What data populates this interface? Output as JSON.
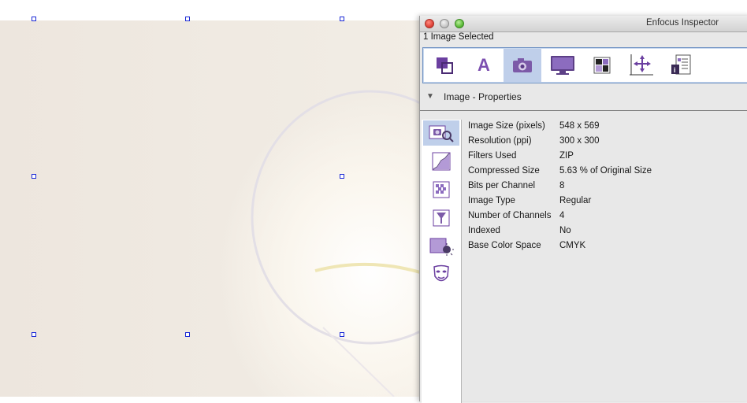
{
  "window": {
    "title": "Enfocus Inspector",
    "selection_label": "1 Image Selected"
  },
  "tabs": [
    {
      "name": "objects-icon"
    },
    {
      "name": "text-icon",
      "glyph": "A"
    },
    {
      "name": "camera-icon",
      "selected": true
    },
    {
      "name": "monitor-icon"
    },
    {
      "name": "color-swatches-icon"
    },
    {
      "name": "move-axes-icon"
    },
    {
      "name": "document-info-icon"
    }
  ],
  "section": {
    "disclosure": "▼",
    "title": "Image - Properties"
  },
  "side_icons": [
    {
      "name": "image-properties-icon",
      "selected": true
    },
    {
      "name": "curve-icon"
    },
    {
      "name": "halftone-icon"
    },
    {
      "name": "filter-funnel-icon"
    },
    {
      "name": "brightness-icon"
    },
    {
      "name": "mask-icon"
    }
  ],
  "properties": [
    {
      "label": "Image Size (pixels)",
      "value": "548 x 569"
    },
    {
      "label": "Resolution (ppi)",
      "value": "300 x 300"
    },
    {
      "label": "Filters Used",
      "value": "ZIP"
    },
    {
      "label": "Compressed Size",
      "value": "5.63 % of Original Size"
    },
    {
      "label": "Bits per Channel",
      "value": "8"
    },
    {
      "label": "Image Type",
      "value": "Regular"
    },
    {
      "label": "Number of Channels",
      "value": "4"
    },
    {
      "label": "Indexed",
      "value": "No"
    },
    {
      "label": "Base Color Space",
      "value": "CMYK"
    }
  ],
  "colors": {
    "accent": "#6b3fa0",
    "selection_handle": "#1d2bd6",
    "tab_selected": "#bfcfea"
  }
}
